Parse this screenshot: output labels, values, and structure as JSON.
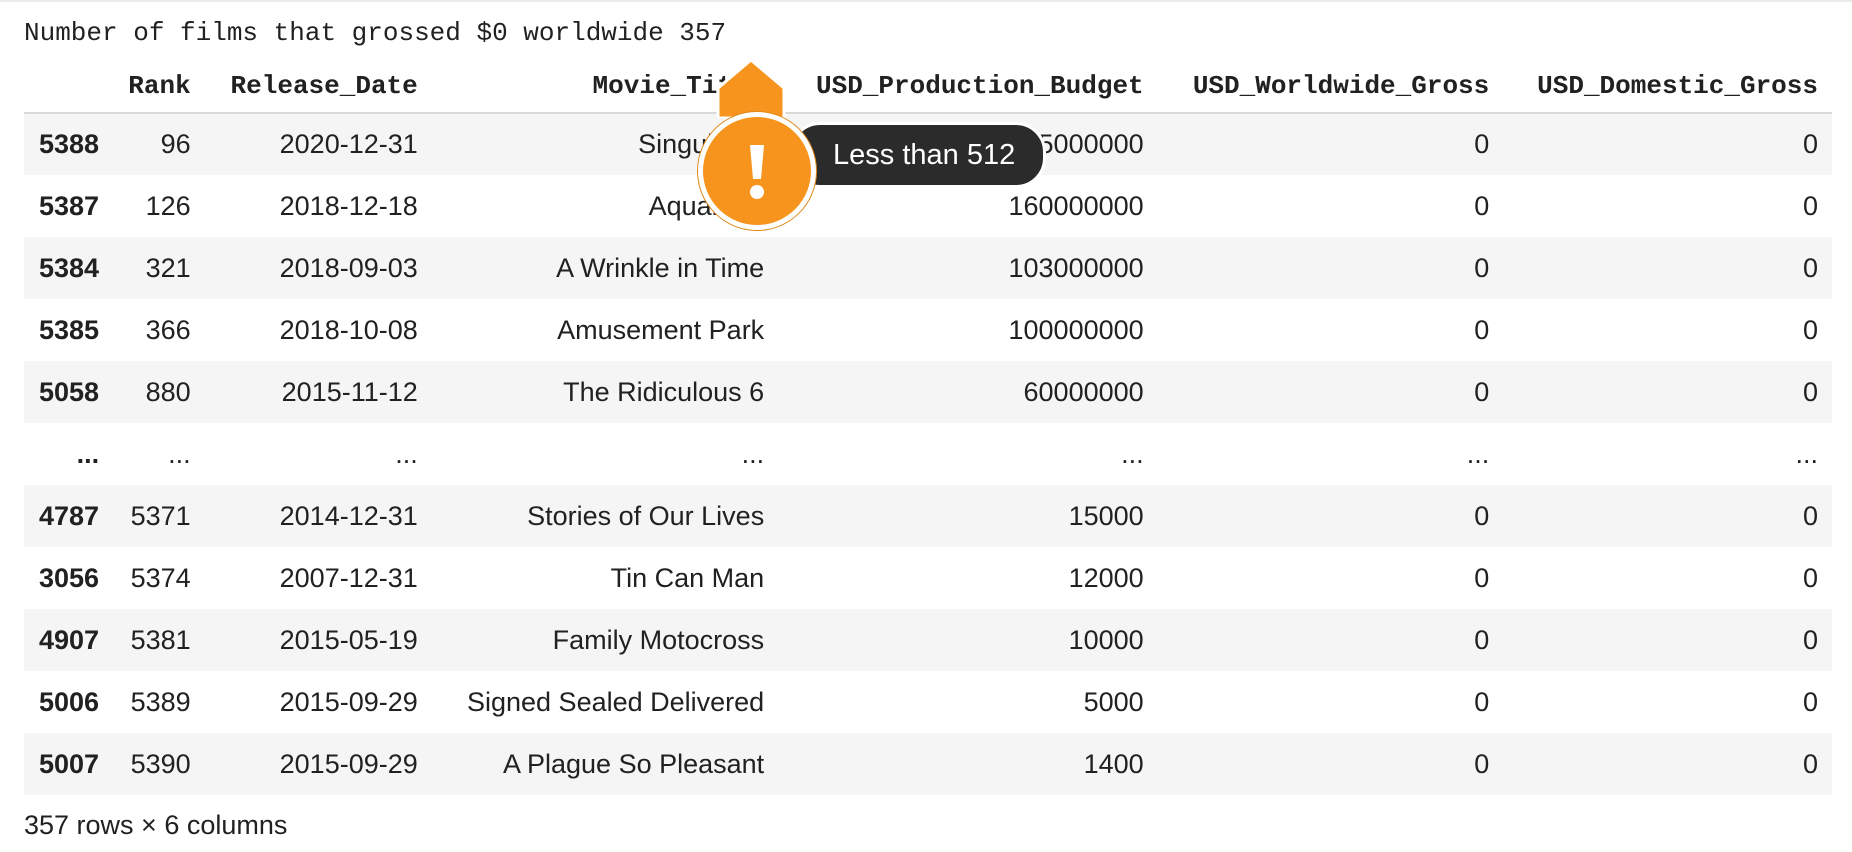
{
  "output": {
    "text": "Number of films that grossed $0 worldwide 357"
  },
  "table": {
    "columns": [
      "",
      "Rank",
      "Release_Date",
      "Movie_Title",
      "USD_Production_Budget",
      "USD_Worldwide_Gross",
      "USD_Domestic_Gross"
    ],
    "rows": [
      {
        "index": "5388",
        "cells": [
          "96",
          "2020-12-31",
          "Singularity",
          "175000000",
          "0",
          "0"
        ]
      },
      {
        "index": "5387",
        "cells": [
          "126",
          "2018-12-18",
          "Aquaman",
          "160000000",
          "0",
          "0"
        ]
      },
      {
        "index": "5384",
        "cells": [
          "321",
          "2018-09-03",
          "A Wrinkle in Time",
          "103000000",
          "0",
          "0"
        ]
      },
      {
        "index": "5385",
        "cells": [
          "366",
          "2018-10-08",
          "Amusement Park",
          "100000000",
          "0",
          "0"
        ]
      },
      {
        "index": "5058",
        "cells": [
          "880",
          "2015-11-12",
          "The Ridiculous 6",
          "60000000",
          "0",
          "0"
        ]
      },
      {
        "index": "...",
        "cells": [
          "...",
          "...",
          "...",
          "...",
          "...",
          "..."
        ]
      },
      {
        "index": "4787",
        "cells": [
          "5371",
          "2014-12-31",
          "Stories of Our Lives",
          "15000",
          "0",
          "0"
        ]
      },
      {
        "index": "3056",
        "cells": [
          "5374",
          "2007-12-31",
          "Tin Can Man",
          "12000",
          "0",
          "0"
        ]
      },
      {
        "index": "4907",
        "cells": [
          "5381",
          "2015-05-19",
          "Family Motocross",
          "10000",
          "0",
          "0"
        ]
      },
      {
        "index": "5006",
        "cells": [
          "5389",
          "2015-09-29",
          "Signed Sealed Delivered",
          "5000",
          "0",
          "0"
        ]
      },
      {
        "index": "5007",
        "cells": [
          "5390",
          "2015-09-29",
          "A Plague So Pleasant",
          "1400",
          "0",
          "0"
        ]
      }
    ],
    "shape": "357 rows × 6 columns"
  },
  "tooltip": {
    "text": "Less than 512",
    "icon": "exclamation-icon",
    "accent": "#f7941d",
    "bubble_color": "#2b2b2b"
  }
}
